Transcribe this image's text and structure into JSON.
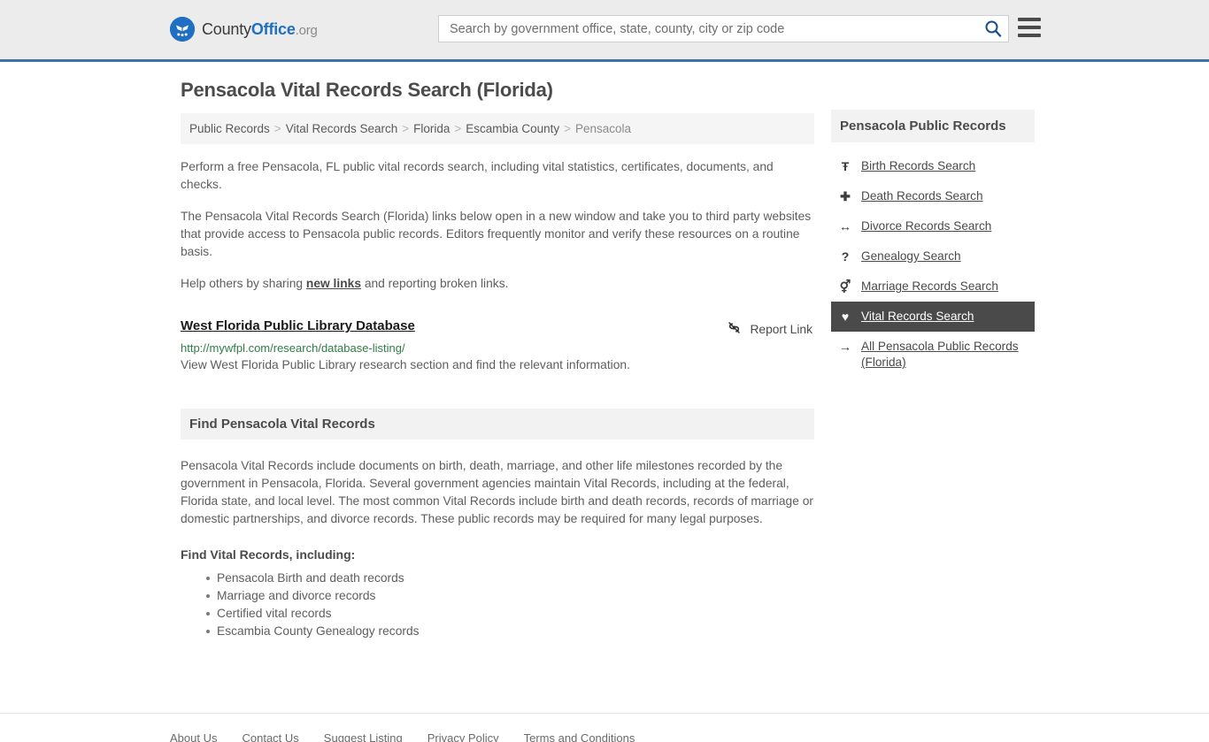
{
  "header": {
    "brand": {
      "part1": "County",
      "part2": "Office",
      "part3": ".org",
      "logo_icon": "eagle-shield-logo"
    },
    "search": {
      "placeholder": "Search by government office, state, county, city or zip code",
      "value": "",
      "button_icon": "search-icon"
    },
    "menu_icon": "hamburger-menu-icon"
  },
  "main": {
    "title": "Pensacola Vital Records Search (Florida)",
    "breadcrumb": [
      {
        "label": "Public Records",
        "current": false
      },
      {
        "label": "Vital Records Search",
        "current": false
      },
      {
        "label": "Florida",
        "current": false
      },
      {
        "label": "Escambia County",
        "current": false
      },
      {
        "label": "Pensacola",
        "current": true
      }
    ],
    "breadcrumb_separator": ">",
    "intro_paragraph": "Perform a free Pensacola, FL public vital records search, including vital statistics, certificates, documents, and checks.",
    "description_paragraph": "The Pensacola Vital Records Search (Florida) links below open in a new window and take you to third party websites that provide access to Pensacola public records. Editors frequently monitor and verify these resources on a routine basis.",
    "help_prefix": "Help others by sharing ",
    "help_link": "new links",
    "help_suffix": " and reporting broken links.",
    "result": {
      "title": "West Florida Public Library Database",
      "url": "http://mywfpl.com/research/database-listing/",
      "description": "View West Florida Public Library research section and find the relevant information.",
      "report_label": "Report Link",
      "report_icon": "broken-link-icon"
    },
    "section": {
      "heading": "Find Pensacola Vital Records",
      "body": "Pensacola Vital Records include documents on birth, death, marriage, and other life milestones recorded by the government in Pensacola, Florida. Several government agencies maintain Vital Records, including at the federal, Florida state, and local level. The most common Vital Records include birth and death records, records of marriage or domestic partnerships, and divorce records. These public records may be required for many legal purposes.",
      "sub_heading": "Find Vital Records, including:",
      "bullets": [
        "Pensacola Birth and death records",
        "Marriage and divorce records",
        "Certified vital records",
        "Escambia County Genealogy records"
      ]
    }
  },
  "sidebar": {
    "heading": "Pensacola Public Records",
    "items": [
      {
        "label": "Birth Records Search",
        "icon": "baby-icon",
        "glyph": "Ŧ",
        "active": false
      },
      {
        "label": "Death Records Search",
        "icon": "cross-icon",
        "glyph": "✚",
        "active": false
      },
      {
        "label": "Divorce Records Search",
        "icon": "left-right-arrow-icon",
        "glyph": "↔",
        "active": false
      },
      {
        "label": "Genealogy Search",
        "icon": "question-mark-icon",
        "glyph": "?",
        "active": false
      },
      {
        "label": "Marriage Records Search",
        "icon": "male-female-symbol-icon",
        "glyph": "⚥",
        "active": false
      },
      {
        "label": "Vital Records Search",
        "icon": "heart-pulse-icon",
        "glyph": "♥",
        "active": true
      },
      {
        "label": "All Pensacola Public Records (Florida)",
        "icon": "arrow-right-icon",
        "glyph": "→",
        "active": false
      }
    ]
  },
  "footer": {
    "links": [
      "About Us",
      "Contact Us",
      "Suggest Listing",
      "Privacy Policy",
      "Terms and Conditions"
    ]
  },
  "colors": {
    "header_bg": "#ececec",
    "header_accent": "#3b72a8",
    "brand_blue": "#1f6fc4",
    "url_green": "#2e7d45",
    "active_item_bg": "#4a4a4a",
    "panel_bg": "#f2f2f2"
  }
}
